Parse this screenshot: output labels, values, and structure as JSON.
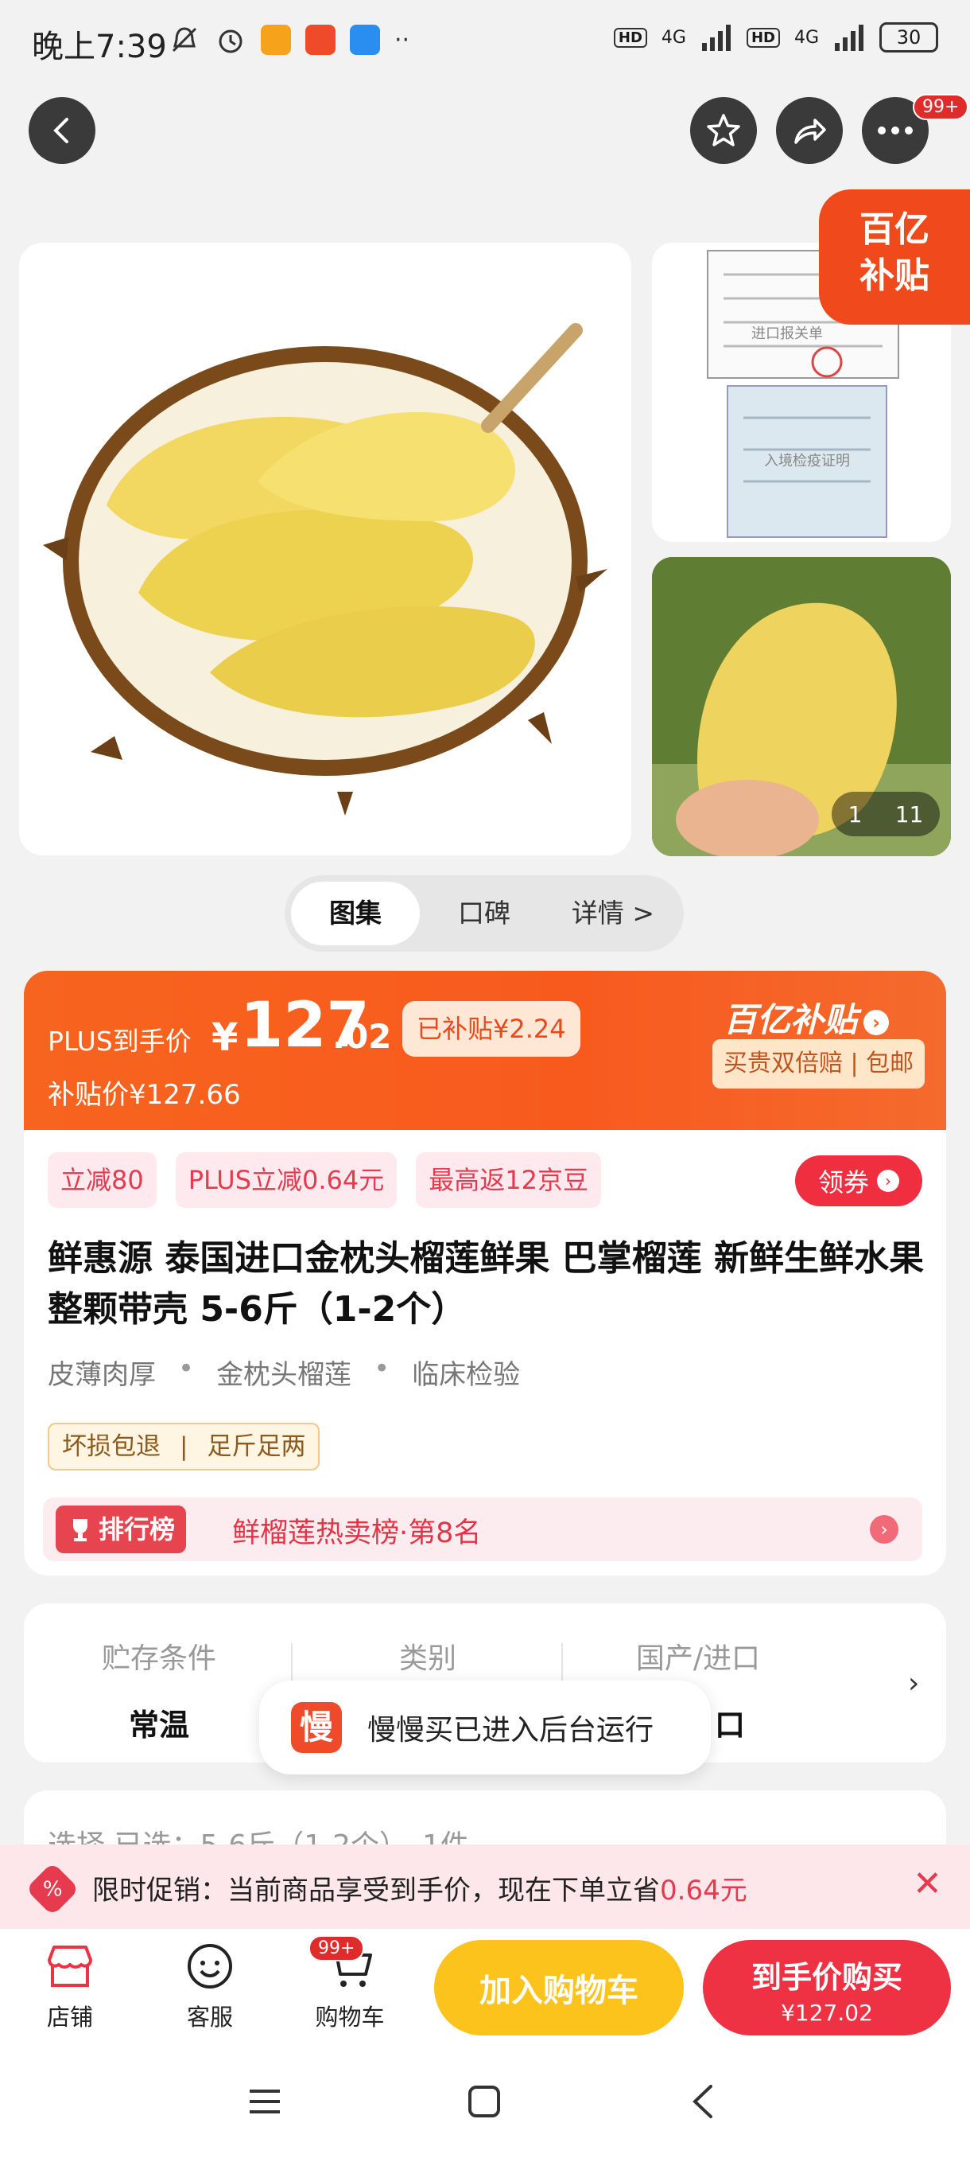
{
  "status_bar": {
    "time": "晚上7:39",
    "network1": "4G",
    "network2": "4G",
    "hd": "HD",
    "battery": "30"
  },
  "top_bar": {
    "more_badge": "99+"
  },
  "gallery": {
    "subsidy_corner_line1": "百亿",
    "subsidy_corner_line2": "补贴",
    "counter_current": "1",
    "counter_total": "11",
    "doc_header": "进口报关单",
    "doc_stamp": "入境检疫证明"
  },
  "tabs": [
    {
      "label": "图集"
    },
    {
      "label": "口碑"
    },
    {
      "label": "详情 >"
    }
  ],
  "price": {
    "plus_label": "PLUS到手价",
    "yen": "¥",
    "integer": "127",
    "decimal": ".02",
    "subsidized_tag": "已补贴¥2.24",
    "subsidy_price": "补贴价¥127.66",
    "logo": "百亿补贴",
    "badge": "买贵双倍赔 | 包邮"
  },
  "promos": [
    {
      "label": "立减80"
    },
    {
      "label": "PLUS立减0.64元"
    },
    {
      "label": "最高返12京豆"
    }
  ],
  "coupon_button": "领券",
  "product": {
    "title": "鲜惠源 泰国进口金枕头榴莲鲜果 巴掌榴莲 新鲜生鲜水果整颗带壳 5-6斤（1-2个）",
    "features": [
      "皮薄肉厚",
      "金枕头榴莲",
      "临床检验"
    ],
    "guarantees": [
      "坏损包退",
      "足斤足两"
    ],
    "rank_tag": "排行榜",
    "rank_text": "鲜榴莲热卖榜·第8名"
  },
  "specs": [
    {
      "key": "贮存条件",
      "value": "常温"
    },
    {
      "key": "类别",
      "value": ""
    },
    {
      "key": "国产/进口",
      "value": "口"
    }
  ],
  "toast": {
    "icon_text": "慢",
    "message": "慢慢买已进入后台运行"
  },
  "selection": {
    "text": "选择   已选：5-6斤（1-2个），1件"
  },
  "promo_strip": {
    "prefix": "限时促销：当前商品享受到手价，现在下单立省",
    "amount": "0.64元",
    "icon": "%"
  },
  "bottom_bar": {
    "store": "店铺",
    "service": "客服",
    "cart": "购物车",
    "cart_badge": "99+",
    "add_to_cart": "加入购物车",
    "buy_line1": "到手价购买",
    "buy_line2": "¥127.02"
  },
  "colors": {
    "accent_orange": "#f7641f",
    "accent_red": "#ee3243",
    "accent_yellow": "#fcc31c"
  }
}
